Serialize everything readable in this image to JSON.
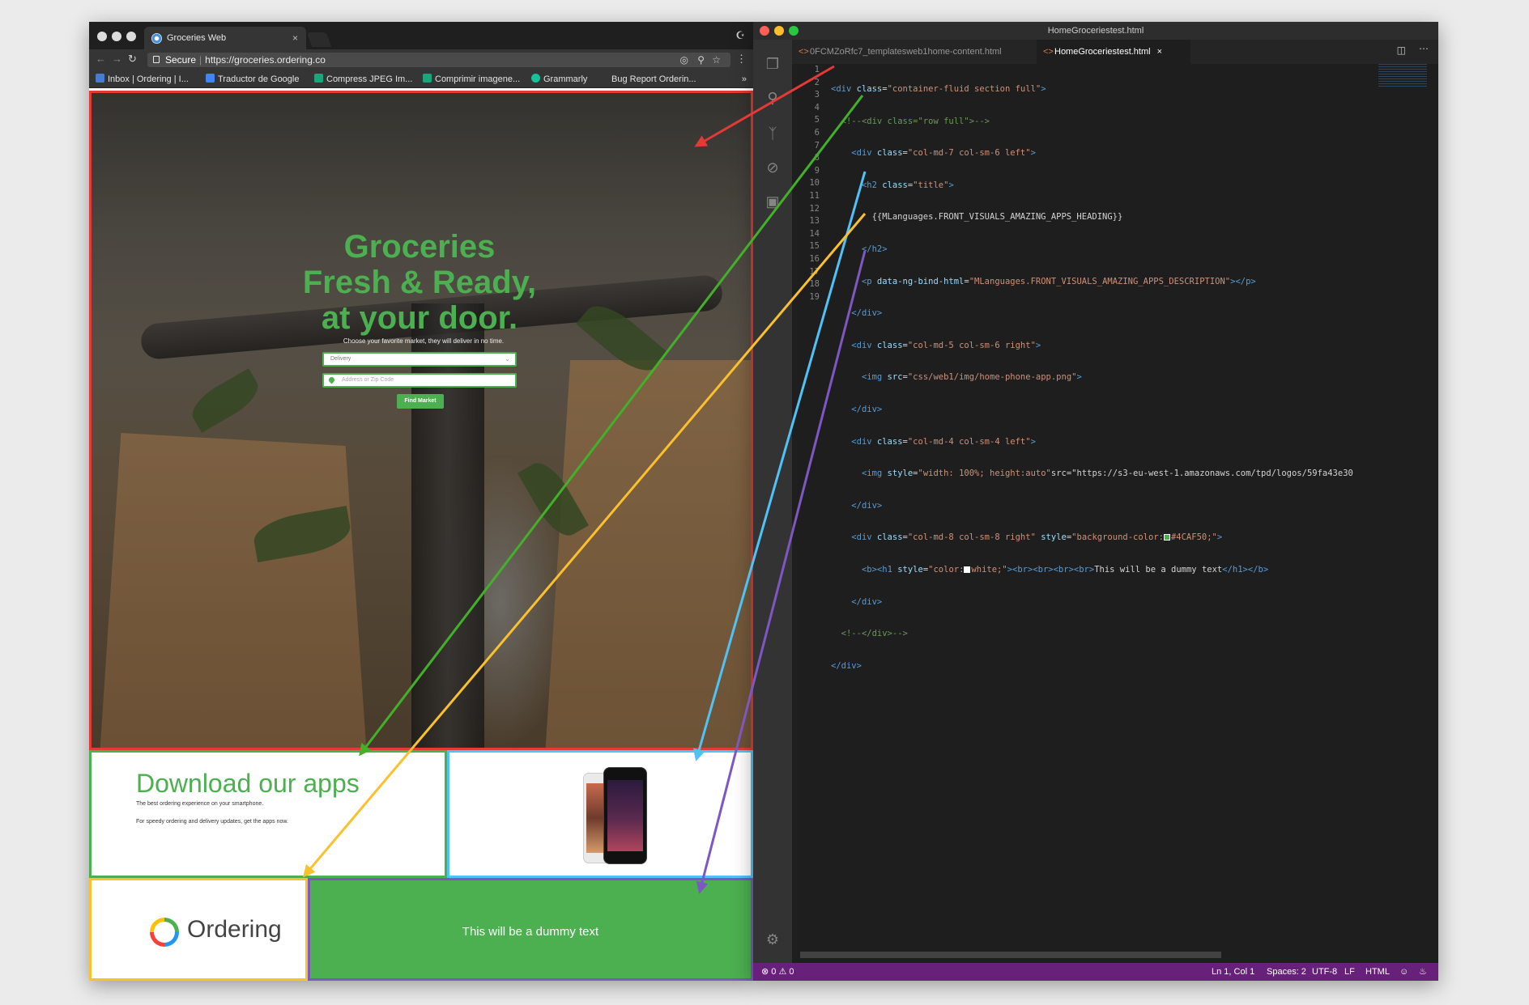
{
  "browser": {
    "tab_title": "Groceries Web",
    "tab_close": "×",
    "secure_label": "Secure",
    "url": "https://groceries.ordering.co",
    "bookmarks": [
      {
        "label": "Inbox | Ordering | I...",
        "color": "#4a7bd0"
      },
      {
        "label": "Traductor de Google",
        "color": "#4285f4"
      },
      {
        "label": "Compress JPEG Im...",
        "color": "#1aa67a"
      },
      {
        "label": "Comprimir imagene...",
        "color": "#1aa67a"
      },
      {
        "label": "Grammarly",
        "color": "#15c39a"
      },
      {
        "label": "Bug Report Orderin...",
        "color": ""
      }
    ],
    "bookmarks_more": "»"
  },
  "page": {
    "hero_title": "Groceries Fresh & Ready, at your door.",
    "hero_subtitle": "Choose your favorite market, they will deliver in no time.",
    "delivery_select": "Delivery",
    "address_placeholder": "Address or Zip Code",
    "find_button": "Find Market",
    "download_title": "Download our apps",
    "download_p1": "The best ordering experience on your smartphone.",
    "download_p2": "For speedy ordering and delivery updates, get the apps now.",
    "logo_text": "Ordering",
    "green_text": "This will be a dummy text",
    "accent_green": "#4CAF50"
  },
  "editor": {
    "window_title": "HomeGroceriestest.html",
    "tabs": [
      {
        "label": "0FCMZoRfc7_templatesweb1home-content.html",
        "active": false
      },
      {
        "label": "HomeGroceriestest.html",
        "active": true
      }
    ],
    "tab_close": "×",
    "line_numbers": [
      "1",
      "2",
      "3",
      "4",
      "5",
      "6",
      "7",
      "8",
      "9",
      "10",
      "11",
      "12",
      "13",
      "14",
      "15",
      "16",
      "17",
      "18",
      "19"
    ],
    "code_lines": [
      "<div class=\"container-fluid section full\">",
      "  <!--<div class=\"row full\">-->",
      "    <div class=\"col-md-7 col-sm-6 left\">",
      "      <h2 class=\"title\">",
      "        {{MLanguages.FRONT_VISUALS_AMAZING_APPS_HEADING}}",
      "      </h2>",
      "      <p data-ng-bind-html=\"MLanguages.FRONT_VISUALS_AMAZING_APPS_DESCRIPTION\"></p>",
      "    </div>",
      "    <div class=\"col-md-5 col-sm-6 right\">",
      "      <img src=\"css/web1/img/home-phone-app.png\">",
      "    </div>",
      "    <div class=\"col-md-4 col-sm-4 left\">",
      "      <img style=\"width: 100%; height:auto\"src=\"https://s3-eu-west-1.amazonaws.com/tpd/logos/59fa43e30",
      "    </div>",
      "    <div class=\"col-md-8 col-sm-8 right\" style=\"background-color:#4CAF50;\">",
      "      <b><h1 style=\"color:white;\"><br><br><br><br>This will be a dummy text</h1></b>",
      "    </div>",
      "  <!--</div>-->",
      "</div>"
    ],
    "status": {
      "errors": "0",
      "warnings": "0",
      "position": "Ln 1, Col 1",
      "spaces": "Spaces: 2",
      "encoding": "UTF-8",
      "eol": "LF",
      "language": "HTML"
    },
    "status_bg": "#68217A"
  },
  "arrow_colors": {
    "red": "#E53935",
    "green": "#43B02A",
    "cyan": "#4FC3F7",
    "yellow": "#FBC02D",
    "purple": "#7E57C2"
  }
}
